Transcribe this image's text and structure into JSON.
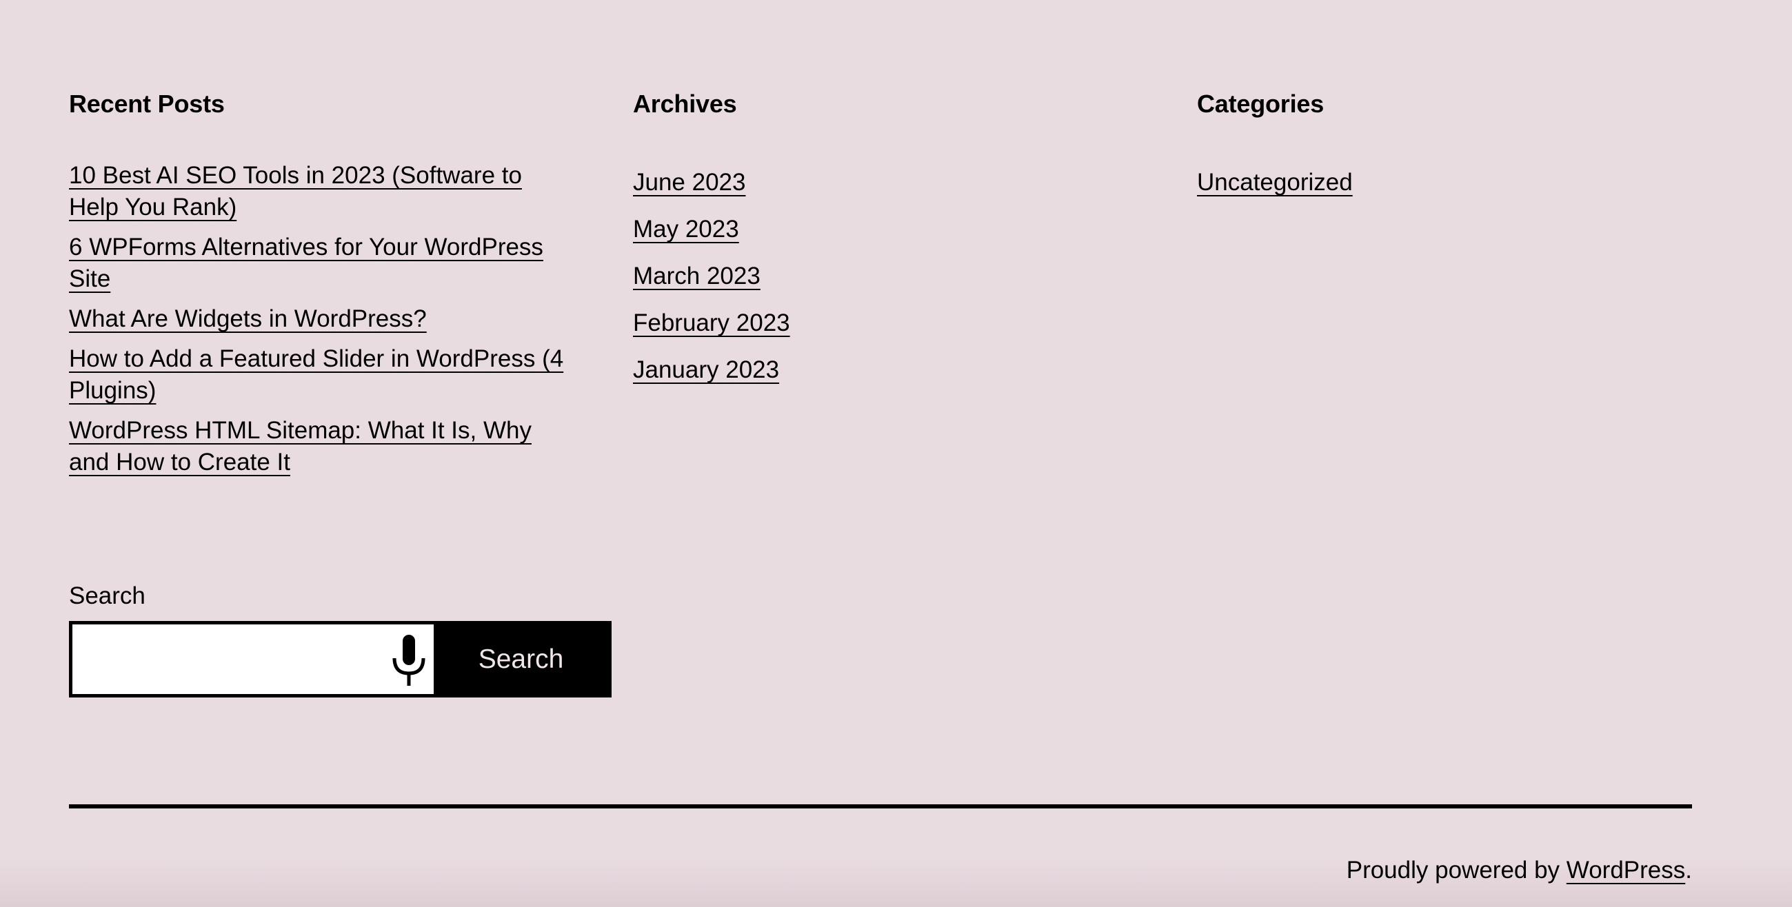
{
  "colors": {
    "background": "#e9dce1",
    "text": "#000000",
    "button_bg": "#000000",
    "button_text": "#f0e6ea",
    "input_bg": "#ffffff"
  },
  "recent_posts": {
    "title": "Recent Posts",
    "items": [
      {
        "label": "10 Best AI SEO Tools in 2023 (Software to Help You Rank)"
      },
      {
        "label": "6 WPForms Alternatives for Your WordPress Site"
      },
      {
        "label": "What Are Widgets in WordPress?"
      },
      {
        "label": "How to Add a Featured Slider in WordPress (4 Plugins)"
      },
      {
        "label": "WordPress HTML Sitemap: What It Is, Why and How to Create It"
      }
    ]
  },
  "archives": {
    "title": "Archives",
    "items": [
      {
        "label": "June 2023"
      },
      {
        "label": "May 2023"
      },
      {
        "label": "March 2023"
      },
      {
        "label": "February 2023"
      },
      {
        "label": "January 2023"
      }
    ]
  },
  "categories": {
    "title": "Categories",
    "items": [
      {
        "label": "Uncategorized"
      }
    ]
  },
  "search": {
    "label": "Search",
    "input_value": "",
    "placeholder": "",
    "mic_icon": "microphone-icon",
    "button_label": "Search"
  },
  "footer": {
    "credit_prefix": "Proudly powered by ",
    "credit_link": "WordPress",
    "credit_suffix": "."
  }
}
